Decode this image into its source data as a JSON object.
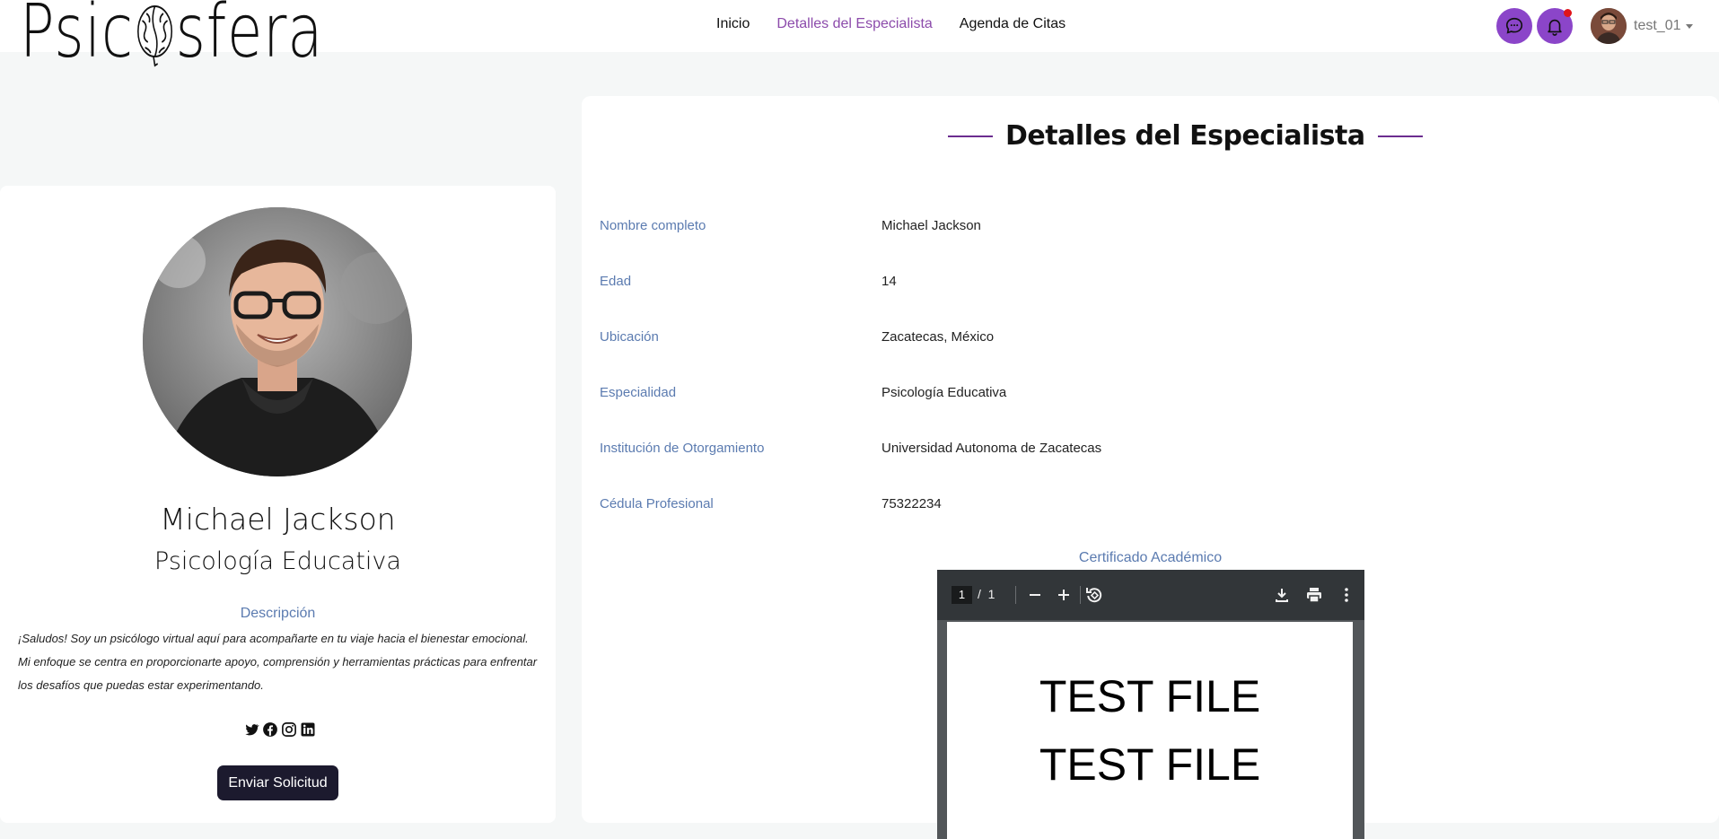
{
  "header": {
    "logo_text": "Psicosfera",
    "nav": [
      {
        "label": "Inicio",
        "active": false
      },
      {
        "label": "Detalles del Especialista",
        "active": true
      },
      {
        "label": "Agenda de Citas",
        "active": false
      }
    ],
    "username": "test_01",
    "icons": [
      "chat-icon",
      "bell-icon"
    ],
    "notification_dot": true,
    "accent_color": "#8b45c9"
  },
  "profile": {
    "name": "Michael Jackson",
    "specialty": "Psicología Educativa",
    "description_title": "Descripción",
    "description": "¡Saludos! Soy un psicólogo virtual aquí para acompañarte en tu viaje hacia el bienestar emocional. Mi enfoque se centra en proporcionarte apoyo, comprensión y herramientas prácticas para enfrentar los desafíos que puedas estar experimentando.",
    "socials": [
      "twitter-icon",
      "facebook-icon",
      "instagram-icon",
      "linkedin-icon"
    ],
    "send_button": "Enviar Solicitud"
  },
  "details": {
    "title": "Detalles del Especialista",
    "rows": [
      {
        "label": "Nombre completo",
        "value": "Michael Jackson"
      },
      {
        "label": "Edad",
        "value": "14"
      },
      {
        "label": "Ubicación",
        "value": "Zacatecas, México"
      },
      {
        "label": "Especialidad",
        "value": "Psicología Educativa"
      },
      {
        "label": "Institución de Otorgamiento",
        "value": "Universidad Autonoma de Zacatecas"
      },
      {
        "label": "Cédula Profesional",
        "value": "75322234"
      }
    ],
    "certificate_title": "Certificado Académico"
  },
  "pdf_viewer": {
    "current_page": "1",
    "page_separator": "/",
    "total_pages": "1",
    "content_lines": [
      "TEST FILE",
      "TEST FILE"
    ]
  }
}
